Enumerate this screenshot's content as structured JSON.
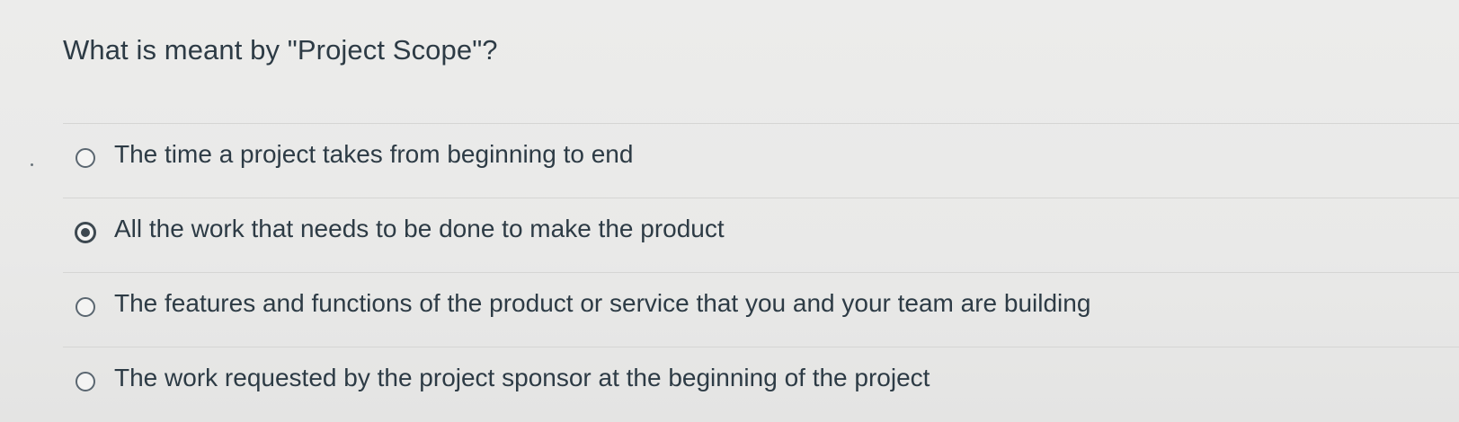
{
  "question": {
    "text": "What is meant by \"Project Scope\"?"
  },
  "answers": [
    {
      "label": "The time a project takes from beginning to end",
      "selected": false
    },
    {
      "label": "All the work that needs to be done to make the product",
      "selected": true
    },
    {
      "label": "The features and functions of the product or service that you and your team are building",
      "selected": false
    },
    {
      "label": "The work requested by the project sponsor at the beginning of the project",
      "selected": false
    }
  ]
}
